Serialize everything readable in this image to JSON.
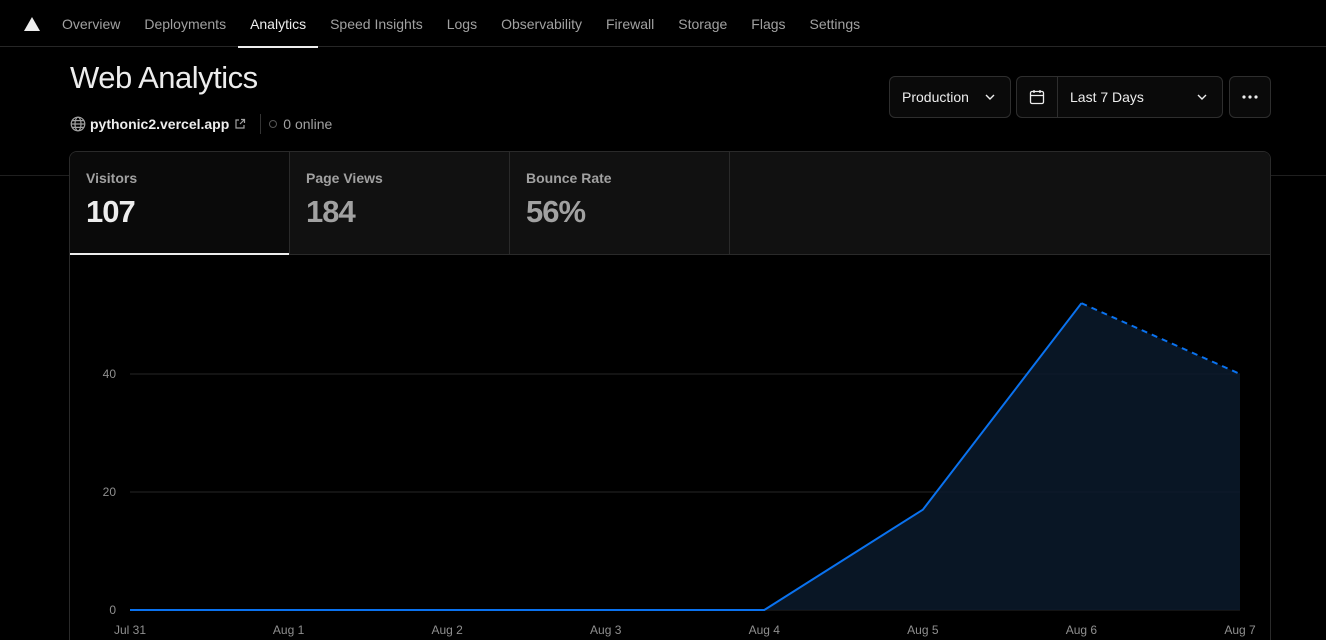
{
  "nav": {
    "tabs": [
      "Overview",
      "Deployments",
      "Analytics",
      "Speed Insights",
      "Logs",
      "Observability",
      "Firewall",
      "Storage",
      "Flags",
      "Settings"
    ],
    "active": "Analytics"
  },
  "header": {
    "title": "Web Analytics",
    "domain": "pythonic2.vercel.app",
    "online": "0 online",
    "environment": "Production",
    "date_range": "Last 7 Days"
  },
  "metrics": [
    {
      "label": "Visitors",
      "value": "107"
    },
    {
      "label": "Page Views",
      "value": "184"
    },
    {
      "label": "Bounce Rate",
      "value": "56%"
    }
  ],
  "colors": {
    "accent": "#0a72ef",
    "background": "#000000",
    "grid": "#262626"
  },
  "chart_data": {
    "type": "area",
    "x": [
      "Jul 31",
      "Aug 1",
      "Aug 2",
      "Aug 3",
      "Aug 4",
      "Aug 5",
      "Aug 6",
      "Aug 7"
    ],
    "series": [
      {
        "values": [
          0,
          0,
          0,
          0,
          0,
          17,
          52,
          40
        ]
      }
    ],
    "projected_from_index": 6,
    "y_ticks": [
      0,
      20,
      40
    ],
    "ylim": [
      0,
      60
    ],
    "grid": true,
    "title": "",
    "xlabel": "",
    "ylabel": ""
  }
}
